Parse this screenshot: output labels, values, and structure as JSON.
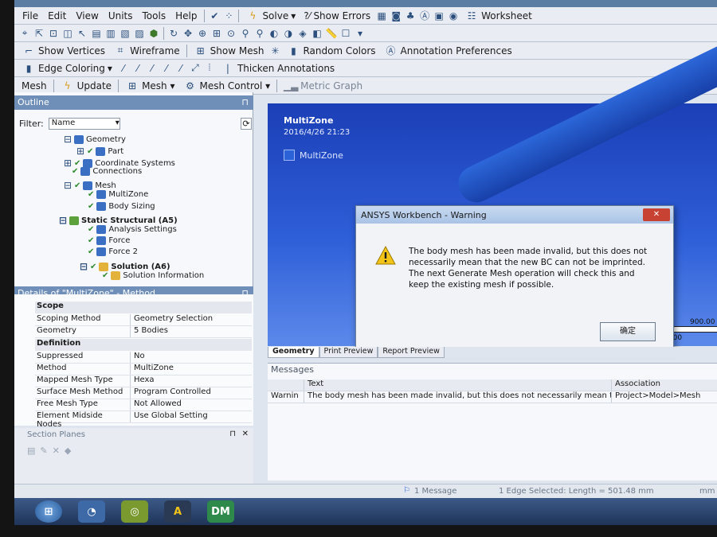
{
  "menu": [
    "File",
    "Edit",
    "View",
    "Units",
    "Tools",
    "Help"
  ],
  "toolbar1": {
    "solve": "Solve",
    "show_errors": "?⁄ Show Errors",
    "worksheet": "Worksheet"
  },
  "toolbar2": {
    "show_vertices": "Show Vertices",
    "wireframe": "Wireframe",
    "show_mesh": "Show Mesh",
    "random_colors": "Random Colors",
    "annotation_prefs": "Annotation Preferences"
  },
  "toolbar3": {
    "edge_coloring": "Edge Coloring",
    "thicken": "Thicken Annotations"
  },
  "toolbar4": {
    "mesh": "Mesh",
    "update": "Update",
    "mesh_menu": "Mesh ▾",
    "mesh_control": "Mesh Control ▾",
    "metric_graph": "Metric Graph"
  },
  "outline": {
    "title": "Outline",
    "filter_label": "Filter:",
    "filter_value": "Name",
    "items": [
      {
        "label": "Geometry",
        "bold": false
      },
      {
        "label": "Part",
        "bold": false
      },
      {
        "label": "Coordinate Systems",
        "bold": false
      },
      {
        "label": "Connections",
        "bold": false
      },
      {
        "label": "Mesh",
        "bold": false
      },
      {
        "label": "MultiZone",
        "bold": false
      },
      {
        "label": "Body Sizing",
        "bold": false
      },
      {
        "label": "Static Structural (A5)",
        "bold": true
      },
      {
        "label": "Analysis Settings",
        "bold": false
      },
      {
        "label": "Force",
        "bold": false
      },
      {
        "label": "Force 2",
        "bold": false
      },
      {
        "label": "Solution (A6)",
        "bold": true
      },
      {
        "label": "Solution Information",
        "bold": false
      }
    ]
  },
  "details": {
    "title": "Details of \"MultiZone\" - Method",
    "groups": {
      "scope": "Scope",
      "definition": "Definition"
    },
    "rows": [
      {
        "k": "Scoping Method",
        "v": "Geometry Selection"
      },
      {
        "k": "Geometry",
        "v": "5 Bodies"
      },
      {
        "k": "Suppressed",
        "v": "No"
      },
      {
        "k": "Method",
        "v": "MultiZone"
      },
      {
        "k": "Mapped Mesh Type",
        "v": "Hexa"
      },
      {
        "k": "Surface Mesh Method",
        "v": "Program Controlled"
      },
      {
        "k": "Free Mesh Type",
        "v": "Not Allowed"
      },
      {
        "k": "Element Midside Nodes",
        "v": "Use Global Setting"
      }
    ]
  },
  "section_planes": {
    "title": "Section Planes"
  },
  "graphics": {
    "title": "MultiZone",
    "date": "2016/4/26 21:23",
    "legend": "MultiZone",
    "scale_max": "900.00",
    "scale_min": "0.00"
  },
  "dialog": {
    "title": "ANSYS Workbench - Warning",
    "close": "✕",
    "message": "The body mesh has been made invalid, but this does not necessarily mean that the new BC can not be imprinted.  The next Generate Mesh operation will check this and keep the existing mesh if possible.",
    "ok": "确定"
  },
  "tabs": [
    "Geometry",
    "Print Preview",
    "Report Preview"
  ],
  "messages": {
    "title": "Messages",
    "col_text": "Text",
    "col_assoc": "Association",
    "row_type": "Warnin",
    "row_text": "The body mesh has been made invalid, but this does not necessarily mean tha",
    "row_assoc": "Project>Model>Mesh"
  },
  "status": {
    "messages": "1 Message",
    "selection": "1 Edge Selected: Length = 501.48 mm",
    "units": "mm"
  },
  "taskbar": {
    "dm_label": "DM",
    "ansys_label": "A"
  },
  "colors": {
    "viewport": "#2e5ed8",
    "panel_title": "#6f8fb8"
  }
}
